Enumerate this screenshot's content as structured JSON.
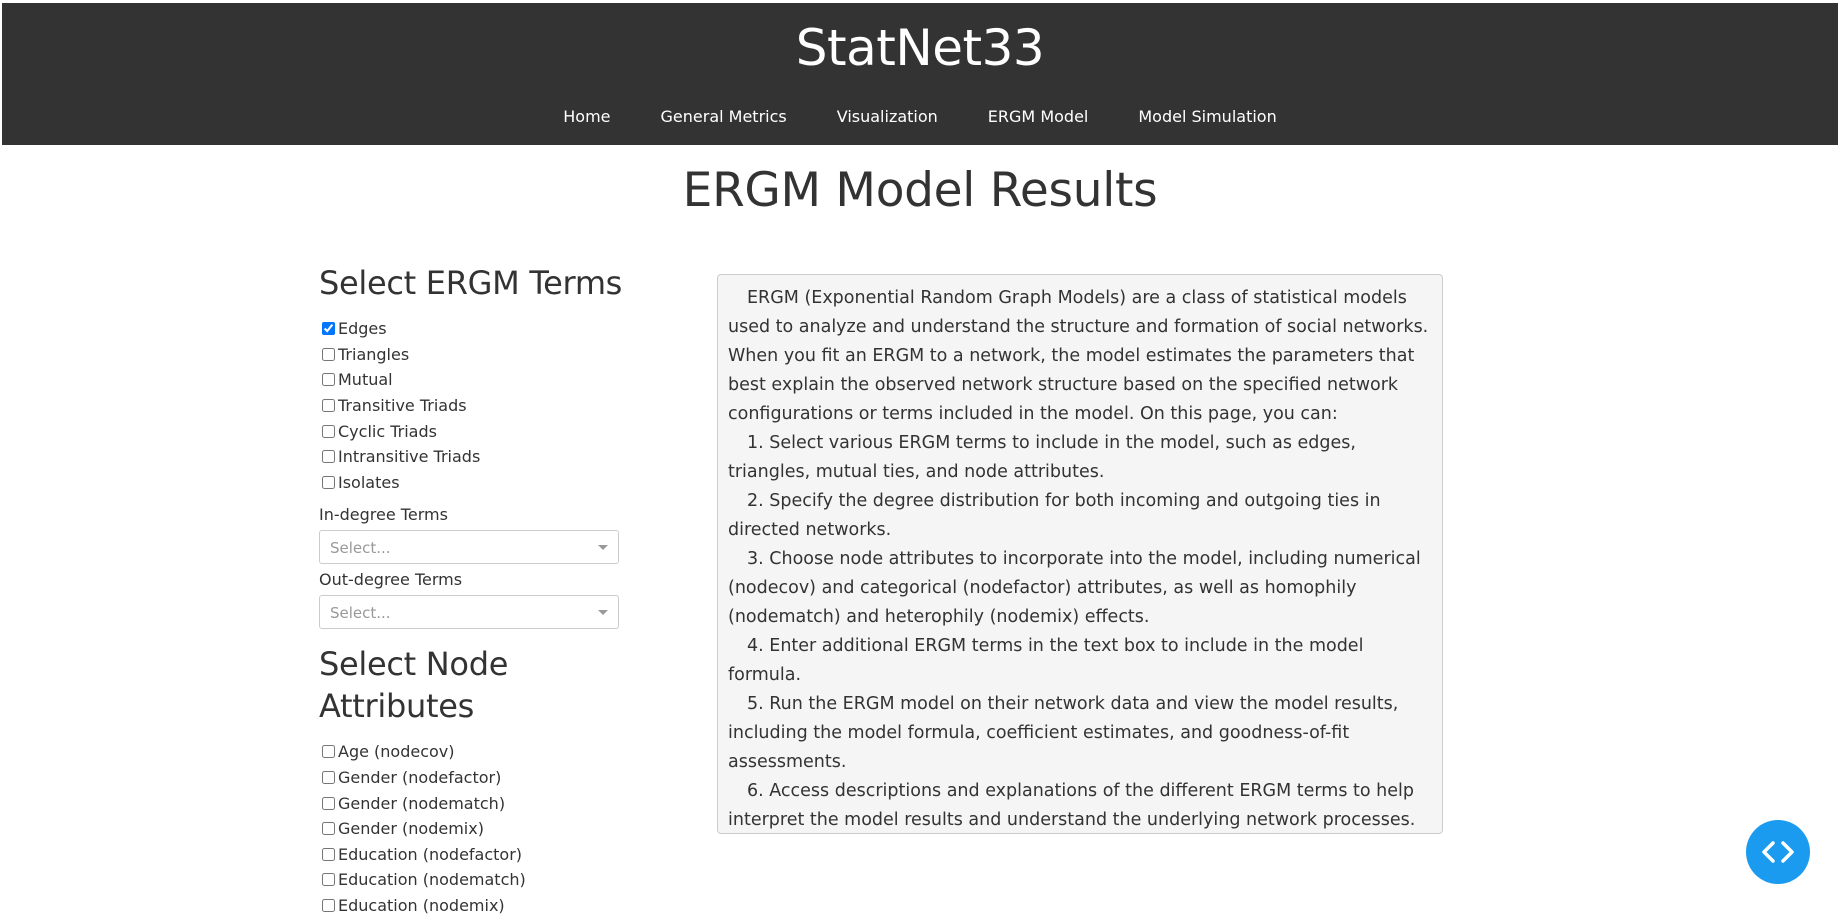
{
  "header": {
    "brand": "StatNet33",
    "nav": [
      "Home",
      "General Metrics",
      "Visualization",
      "ERGM Model",
      "Model Simulation"
    ]
  },
  "page_title": "ERGM Model Results",
  "sidebar": {
    "terms_title": "Select ERGM Terms",
    "terms": [
      {
        "label": "Edges",
        "checked": true
      },
      {
        "label": "Triangles",
        "checked": false
      },
      {
        "label": "Mutual",
        "checked": false
      },
      {
        "label": "Transitive Triads",
        "checked": false
      },
      {
        "label": "Cyclic Triads",
        "checked": false
      },
      {
        "label": "Intransitive Triads",
        "checked": false
      },
      {
        "label": "Isolates",
        "checked": false
      }
    ],
    "indegree_label": "In-degree Terms",
    "indegree_placeholder": "Select...",
    "outdegree_label": "Out-degree Terms",
    "outdegree_placeholder": "Select...",
    "node_title_line1": "Select Node",
    "node_title_line2": "Attributes",
    "attributes": [
      {
        "label": "Age (nodecov)",
        "checked": false
      },
      {
        "label": "Gender (nodefactor)",
        "checked": false
      },
      {
        "label": "Gender (nodematch)",
        "checked": false
      },
      {
        "label": "Gender (nodemix)",
        "checked": false
      },
      {
        "label": "Education (nodefactor)",
        "checked": false
      },
      {
        "label": "Education (nodematch)",
        "checked": false
      },
      {
        "label": "Education (nodemix)",
        "checked": false
      }
    ]
  },
  "description": {
    "intro": "ERGM (Exponential Random Graph Models) are a class of statistical models used to analyze and understand the structure and formation of social networks. When you fit an ERGM to a network, the model estimates the parameters that best explain the observed network structure based on the specified network configurations or terms included in the model. On this page, you can:",
    "items": [
      "1. Select various ERGM terms to include in the model, such as edges, triangles, mutual ties, and node attributes.",
      "2. Specify the degree distribution for both incoming and outgoing ties in directed networks.",
      "3. Choose node attributes to incorporate into the model, including numerical (nodecov) and categorical (nodefactor) attributes, as well as homophily (nodematch) and heterophily (nodemix) effects.",
      "4. Enter additional ERGM terms in the text box to include in the model formula.",
      "5. Run the ERGM model on their network data and view the model results, including the model formula, coefficient estimates, and goodness-of-fit assessments.",
      "6. Access descriptions and explanations of the different ERGM terms to help interpret the model results and understand the underlying network processes."
    ]
  },
  "fab": {
    "icon": "code-icon",
    "color": "#1a9bf0"
  }
}
